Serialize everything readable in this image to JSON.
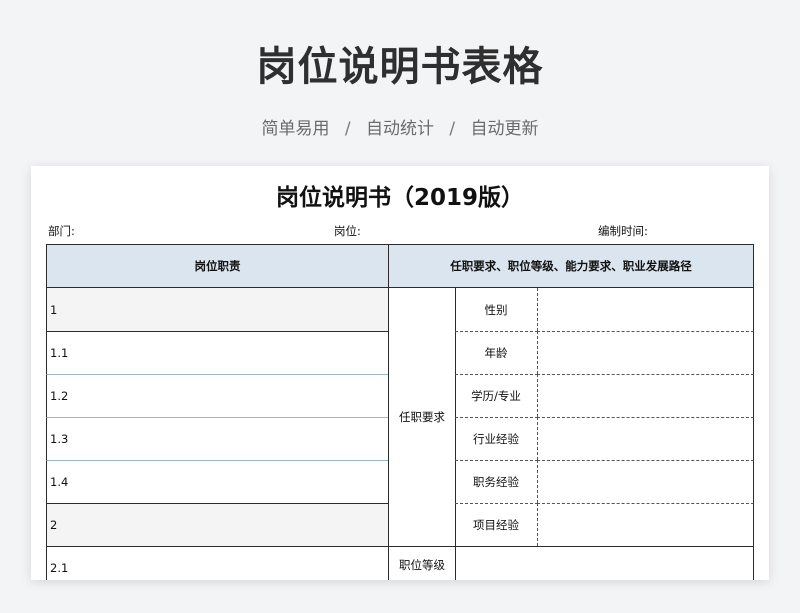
{
  "header": {
    "title": "岗位说明书表格",
    "subtitle_items": [
      "简单易用",
      "自动统计",
      "自动更新"
    ],
    "separator": "/"
  },
  "document": {
    "title": "岗位说明书（2019版）",
    "dept_label": "部门:",
    "position_label": "岗位:",
    "prepared_time_label": "编制时间:"
  },
  "table": {
    "col_headers": {
      "duties": "岗位职责",
      "requirements": "任职要求、职位等级、能力要求、职业发展路径"
    },
    "duty_rows": [
      "1",
      "1.1",
      "1.2",
      "1.3",
      "1.4",
      "2",
      "2.1"
    ],
    "req_group_label": "任职要求",
    "req_items": [
      "性别",
      "年龄",
      "学历/专业",
      "行业经验",
      "职务经验",
      "项目经验"
    ],
    "next_group_label": "职位等级"
  },
  "colors": {
    "header_bg": "#dbe5f0",
    "page_bg": "#f3f4f6"
  }
}
